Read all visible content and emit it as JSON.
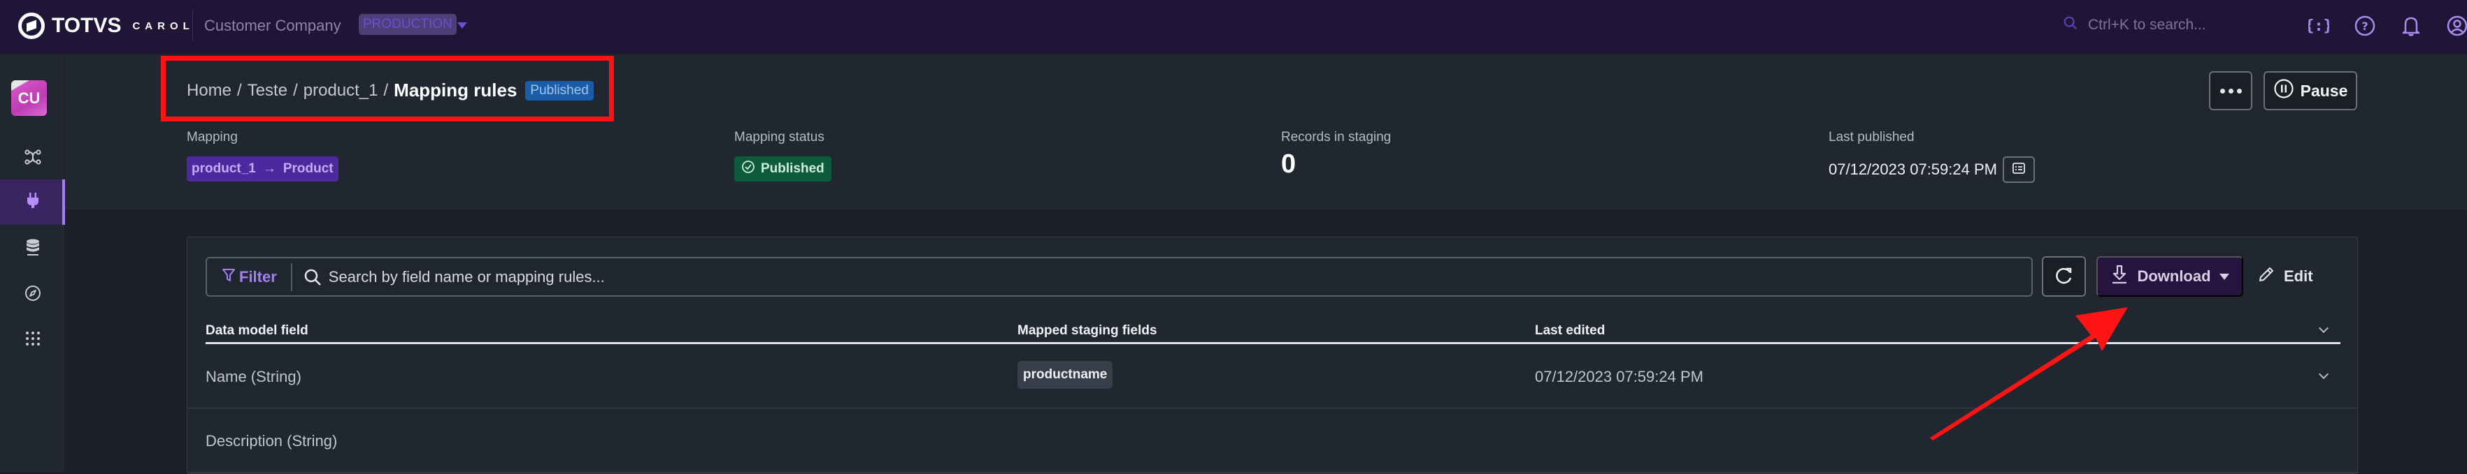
{
  "topbar": {
    "brand": "TOTVS",
    "brand_sub": "CAROL",
    "company": "Customer Company",
    "environment": "PRODUCTION",
    "search_placeholder": "Ctrl+K to search...",
    "icons": [
      "json-braces-icon",
      "help-icon",
      "bell-icon",
      "user-icon"
    ]
  },
  "sidebar": {
    "avatar_initials": "CU",
    "items": [
      {
        "name": "pipelines",
        "icon": "pipeline-icon",
        "active": false
      },
      {
        "name": "connectors",
        "icon": "plug-icon",
        "active": true
      },
      {
        "name": "data-storage",
        "icon": "database-icon",
        "active": false
      },
      {
        "name": "explore",
        "icon": "compass-icon",
        "active": false
      },
      {
        "name": "apps",
        "icon": "grid-icon",
        "active": false
      }
    ]
  },
  "header": {
    "breadcrumb": [
      "Home",
      "Teste",
      "product_1"
    ],
    "separator": "/",
    "title": "Mapping rules",
    "title_badge": "Published",
    "more_label": "More actions",
    "pause_label": "Pause",
    "meta": {
      "mapping_label": "Mapping",
      "mapping_source": "product_1",
      "mapping_arrow": "→",
      "mapping_target": "Product",
      "status_label": "Mapping status",
      "status_value": "Published",
      "records_label": "Records in staging",
      "records_value": "0",
      "last_published_label": "Last published",
      "last_published_value": "07/12/2023 07:59:24 PM"
    }
  },
  "toolbar": {
    "filter_label": "Filter",
    "search_placeholder": "Search by field name or mapping rules...",
    "search_value": "",
    "download_label": "Download",
    "edit_label": "Edit"
  },
  "table": {
    "columns": [
      "Data model field",
      "Mapped staging fields",
      "Last edited"
    ],
    "rows": [
      {
        "field": "Name (String)",
        "staging": "productname",
        "last_edited": "07/12/2023 07:59:24 PM"
      },
      {
        "field": "Description (String)",
        "staging": "",
        "last_edited": ""
      }
    ]
  },
  "colors": {
    "accent": "#a57ff0",
    "topbar_bg": "#1f1537",
    "annotation": "#ff1414",
    "published_green": "#0d5b3a",
    "published_blue": "#1b5ca8"
  }
}
